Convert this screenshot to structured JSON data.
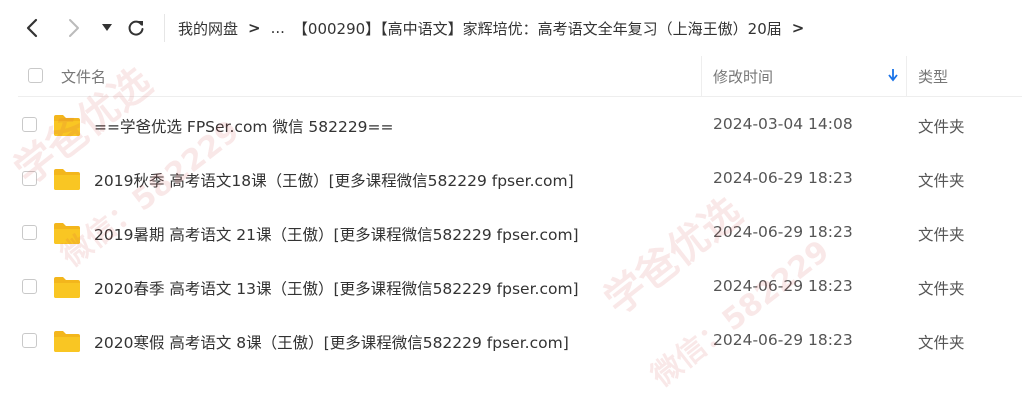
{
  "toolbar": {
    "back_icon": "chevron-left-icon",
    "forward_icon": "chevron-right-icon",
    "dropdown_icon": "triangle-down-icon",
    "refresh_icon": "refresh-icon"
  },
  "breadcrumb": {
    "items": [
      {
        "label": "我的网盘"
      },
      {
        "label": "..."
      },
      {
        "label": "【000290】【高中语文】家辉培优：高考语文全年复习（上海王傲）20届"
      }
    ],
    "separator": ">"
  },
  "table": {
    "headers": {
      "name": "文件名",
      "modified": "修改时间",
      "type": "类型"
    },
    "sort": {
      "column": "modified",
      "direction": "down",
      "icon": "arrow-down-icon",
      "color": "#1a73e8"
    },
    "rows": [
      {
        "name": "==学爸优选 FPSer.com 微信 582229==",
        "modified": "2024-03-04 14:08",
        "type": "文件夹"
      },
      {
        "name": "2019秋季 高考语文18课（王傲）[更多课程微信582229 fpser.com]",
        "modified": "2024-06-29 18:23",
        "type": "文件夹"
      },
      {
        "name": "2019暑期 高考语文 21课（王傲）[更多课程微信582229 fpser.com]",
        "modified": "2024-06-29 18:23",
        "type": "文件夹"
      },
      {
        "name": "2020春季 高考语文 13课（王傲）[更多课程微信582229 fpser.com]",
        "modified": "2024-06-29 18:23",
        "type": "文件夹"
      },
      {
        "name": "2020寒假 高考语文 8课（王傲）[更多课程微信582229 fpser.com]",
        "modified": "2024-06-29 18:23",
        "type": "文件夹"
      }
    ]
  },
  "colors": {
    "folder": "#f9c623",
    "folder_tab": "#f3b61c",
    "watermark": "#d25050"
  },
  "watermark": {
    "text_1": "学爸优选",
    "text_2": "微信：582229"
  }
}
